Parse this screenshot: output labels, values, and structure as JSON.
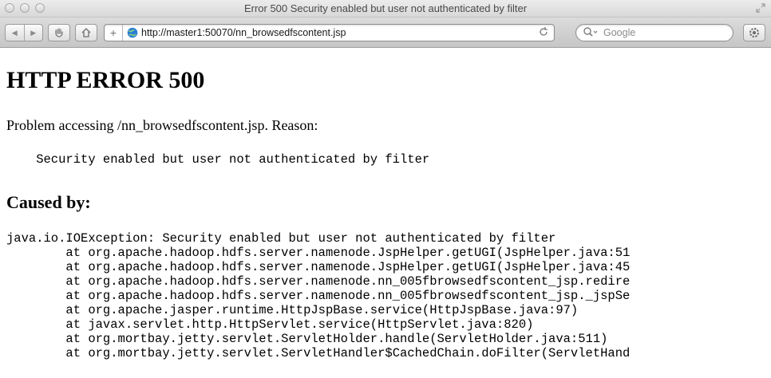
{
  "window": {
    "title": "Error 500 Security enabled but user not authenticated by filter"
  },
  "toolbar": {
    "back_glyph": "◀",
    "forward_glyph": "▶",
    "url": "http://master1:50070/nn_browsedfscontent.jsp",
    "search_placeholder": "Google",
    "icons": [
      "back-icon",
      "forward-icon",
      "reader-icon",
      "home-icon",
      "add-bookmark-icon",
      "globe-icon",
      "reload-icon",
      "search-icon",
      "settings-icon"
    ]
  },
  "page": {
    "heading": "HTTP ERROR 500",
    "problem": "Problem accessing /nn_browsedfscontent.jsp. Reason:",
    "reason": "    Security enabled but user not authenticated by filter",
    "caused_by": "Caused by:",
    "stack": [
      "java.io.IOException: Security enabled but user not authenticated by filter",
      "\tat org.apache.hadoop.hdfs.server.namenode.JspHelper.getUGI(JspHelper.java:51",
      "\tat org.apache.hadoop.hdfs.server.namenode.JspHelper.getUGI(JspHelper.java:45",
      "\tat org.apache.hadoop.hdfs.server.namenode.nn_005fbrowsedfscontent_jsp.redire",
      "\tat org.apache.hadoop.hdfs.server.namenode.nn_005fbrowsedfscontent_jsp._jspSe",
      "\tat org.apache.jasper.runtime.HttpJspBase.service(HttpJspBase.java:97)",
      "\tat javax.servlet.http.HttpServlet.service(HttpServlet.java:820)",
      "\tat org.mortbay.jetty.servlet.ServletHolder.handle(ServletHolder.java:511)",
      "\tat org.mortbay.jetty.servlet.ServletHandler$CachedChain.doFilter(ServletHand"
    ]
  },
  "colors": {
    "chrome_top": "#ececec",
    "toolbar_bottom": "#c6c6c6",
    "globe": "#2a7fd4"
  }
}
